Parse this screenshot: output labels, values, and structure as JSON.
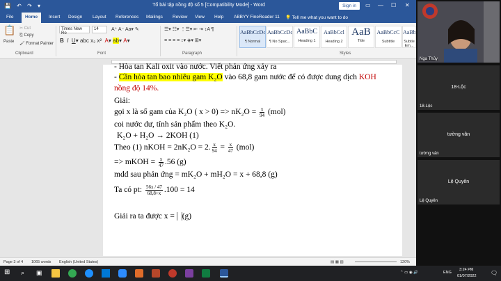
{
  "titlebar": {
    "title": "Tổ bài tập nồng độ số 5 [Compatibility Mode] - Word",
    "signin": "Sign in",
    "quick_access": "💾 ↶ ↷ ▾"
  },
  "tabs": [
    "File",
    "Home",
    "Insert",
    "Design",
    "Layout",
    "References",
    "Mailings",
    "Review",
    "View",
    "Help",
    "ABBYY FineReader 11",
    "💡 Tell me what you want to do"
  ],
  "ribbon": {
    "paste": "Paste",
    "cut": "Cut",
    "copy": "Copy",
    "format_painter": "Format Painter",
    "clipboard": "Clipboard",
    "font_name": "Times New Ro",
    "font_size": "14",
    "font": "Font",
    "paragraph": "Paragraph",
    "styles_label": "Styles",
    "styles": [
      {
        "preview": "AaBbCcDc",
        "name": "¶ Normal"
      },
      {
        "preview": "AaBbCcDc",
        "name": "¶ No Spac..."
      },
      {
        "preview": "AaBbC",
        "name": "Heading 1"
      },
      {
        "preview": "AaBbCcl",
        "name": "Heading 2"
      },
      {
        "preview": "AaB",
        "name": "Title"
      },
      {
        "preview": "AaBbCcC",
        "name": "Subtitle"
      },
      {
        "preview": "AaBbCcDc",
        "name": "Subtle Em..."
      }
    ]
  },
  "document": {
    "line0": "- Hòa tan Kali oxit vào nước. Viết phản ứng xảy ra",
    "line1_dash": "- ",
    "line1_hl": "Cần hòa tan bao nhiêu gam K₂O",
    "line1_rest": " vào 68,8 gam nước để có được dung dịch ",
    "line1_red": "KOH",
    "line2_red": "nồng độ 14%.",
    "line3": "Giải:",
    "line4_a": "gọi x là số gam của K₂O ( x > 0) => nK₂O = ",
    "line4_num": "x",
    "line4_den": "94",
    "line4_b": " (mol)",
    "line5": "coi nước dư, tính sản phẩm theo K₂O.",
    "line6": "K₂O  + H₂O → 2KOH (1)",
    "line7_a": "Theo (1) nKOH = 2nK₂O = 2.",
    "line7_num1": "x",
    "line7_den1": "94",
    "line7_eq": " = ",
    "line7_num2": "x",
    "line7_den2": "47",
    "line7_b": " (mol)",
    "line8_a": "=> mKOH = ",
    "line8_num": "x",
    "line8_den": "47",
    "line8_b": ".56 (g)",
    "line9": "mdd sau phản ứng = mK₂O + mH₂O = x + 68,8 (g)",
    "line10_a": "Ta có pt: ",
    "line10_num": "56x / 47",
    "line10_den": "68,8+x",
    "line10_b": ".100 = 14",
    "line11_a": "Giải ra ta được x = ",
    "line11_b": "(g)"
  },
  "status": {
    "page": "Page 3 of 4",
    "words": "1065 words",
    "lang": "English (United States)",
    "zoom": "120%"
  },
  "taskbar": {
    "lang": "ENG",
    "time": "3:24 PM",
    "date": "01/07/2022"
  },
  "participants": [
    {
      "name": "Nga Thủy",
      "center": ""
    },
    {
      "name": "18-Lộc",
      "center": "18-Lộc"
    },
    {
      "name": "tường vân",
      "center": "tường vân"
    },
    {
      "name": "Lệ Quyên",
      "center": "Lệ Quyên"
    }
  ]
}
